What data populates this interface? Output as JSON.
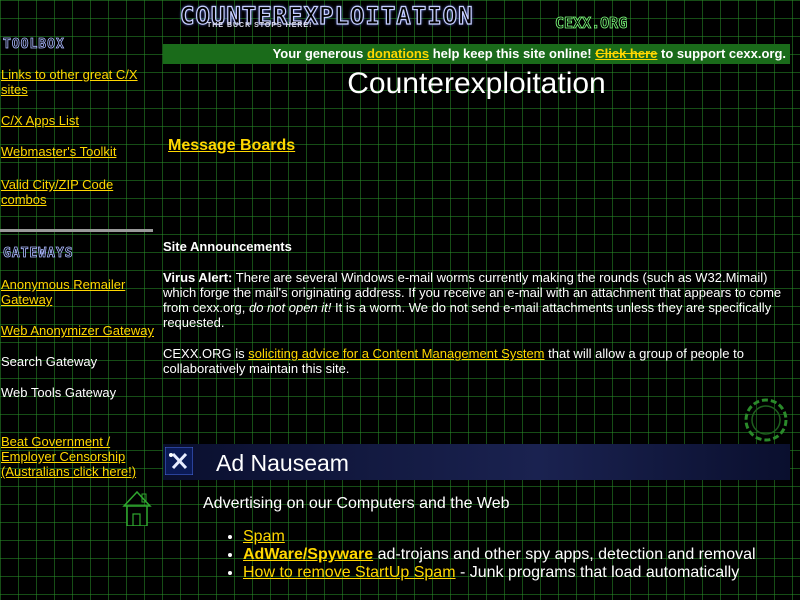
{
  "banner": {
    "logo": "COUNTEREXPLOITATION",
    "tagline": "THE BUCK STOPS HERE!",
    "site": "CEXX.ORG"
  },
  "sidebar": {
    "toolbox_heading": "TOOLBOX",
    "toolbox_links": [
      "Links to other great C/X sites",
      "C/X Apps List",
      "Webmaster's Toolkit",
      "Valid City/ZIP Code combos"
    ],
    "gateways_heading": "GATEWAYS",
    "gateway_links": [
      "Anonymous Remailer Gateway",
      "Web Anonymizer Gateway"
    ],
    "gateway_text": [
      "Search Gateway",
      "Web Tools Gateway"
    ],
    "censorship_link": "Beat Government / Employer Censorship (Australians click here!)"
  },
  "donation": {
    "pre": "Your generous",
    "link": "donations",
    "mid": "help keep this site online!",
    "click": "Click here",
    "post": "to support cexx.org."
  },
  "main": {
    "title": "Counterexploitation",
    "message_boards": "Message Boards",
    "announcements_title": "Site Announcements",
    "virus_label": "Virus Alert:",
    "virus_text1": "There are several Windows e-mail worms currently making the rounds (such as W32.Mimail) which forge the mail's originating address. If you receive an e-mail with an attachment that appears to come from cexx.org,",
    "virus_em": "do not open it!",
    "virus_text2": "It is a worm. We do not send e-mail attachments unless they are specifically requested.",
    "cms_pre": "CEXX.ORG is",
    "cms_link": "soliciting advice for a Content Management System",
    "cms_post": "that will allow a group of people to collaboratively maintain this site."
  },
  "ad_section": {
    "title": "Ad Nauseam",
    "subtitle": "Advertising on our Computers and the Web",
    "items": [
      {
        "link": "Spam",
        "text": ""
      },
      {
        "link": "AdWare/Spyware",
        "text": " ad-trojans and other spy apps, detection and removal"
      },
      {
        "link": "How to remove StartUp Spam",
        "text": " - Junk programs that load automatically"
      }
    ]
  },
  "colors": {
    "background": "#000000",
    "grid": "#288c28",
    "link": "#ffd700",
    "donation_bar": "#1a6b1a",
    "ad_header": "#1a2250"
  }
}
